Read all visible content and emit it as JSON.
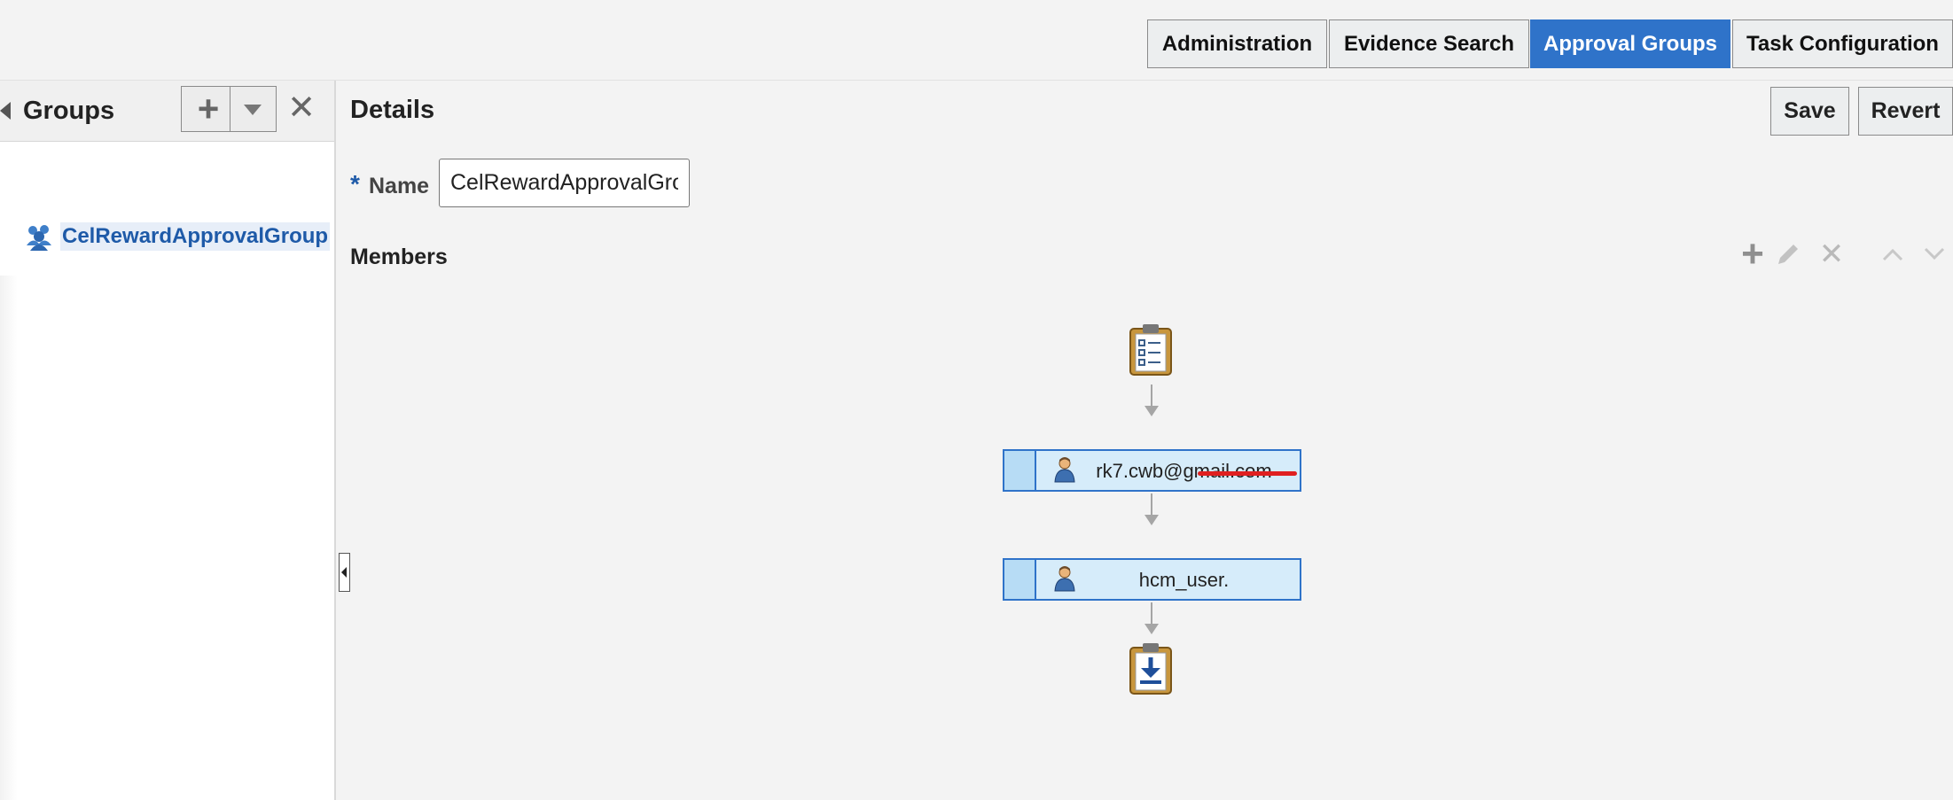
{
  "tabs": [
    "Administration",
    "Evidence Search",
    "Approval Groups",
    "Task Configuration"
  ],
  "active_tab": "Approval Groups",
  "groups_panel": {
    "title": "Groups",
    "items": [
      {
        "label": "CelRewardApprovalGroup",
        "selected": true
      }
    ]
  },
  "details": {
    "title": "Details",
    "save_label": "Save",
    "revert_label": "Revert",
    "name_label": "Name",
    "required_marker": "*",
    "name_value": "CelRewardApprovalGroup",
    "members_title": "Members"
  },
  "members": [
    {
      "label": "rk7.cwb@",
      "redacted_suffix": "gmail.com"
    },
    {
      "label": "hcm_user."
    }
  ],
  "colors": {
    "accent": "#2f73c9",
    "node_fill": "#d6ecfa",
    "node_cap": "#b7dcf5",
    "link": "#1e5aa8",
    "redaction": "#e02020"
  },
  "icons": [
    "add-icon",
    "dropdown-arrow-icon",
    "delete-icon",
    "group-icon",
    "edit-icon",
    "move-up-icon",
    "move-down-icon",
    "clipboard-start-icon",
    "clipboard-end-icon",
    "person-icon",
    "collapse-panel-icon"
  ]
}
